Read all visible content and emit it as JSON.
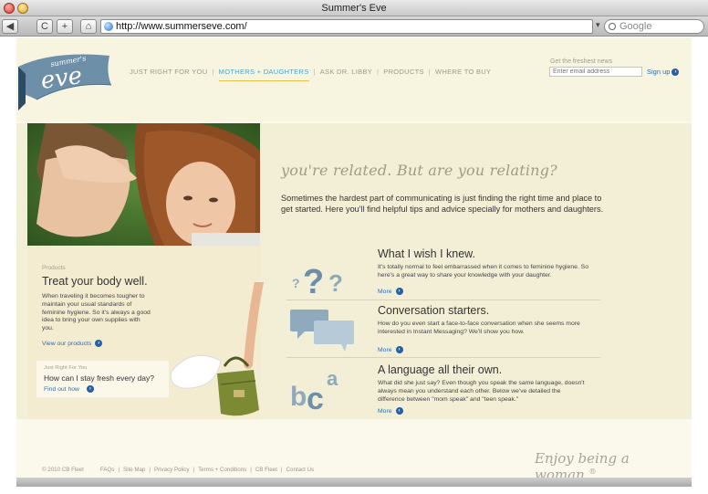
{
  "browser": {
    "window_title": "Summer's Eve",
    "url": "http://www.summerseve.com/",
    "search_placeholder": "Google",
    "buttons": {
      "back": "◀",
      "reload": "C",
      "add": "+",
      "home": "⌂"
    }
  },
  "brand": {
    "logo_small": "summer's",
    "logo_large": "eve",
    "colors": {
      "logo_blue": "#6d8fa8",
      "link_blue": "#2a6fb0",
      "nav_active": "#4aa5c8",
      "underline_gold": "#e6c14a"
    }
  },
  "nav": {
    "items": [
      {
        "label": "JUST RIGHT FOR YOU",
        "active": false
      },
      {
        "label": "MOTHERS + DAUGHTERS",
        "active": true
      },
      {
        "label": "ASK DR. LIBBY",
        "active": false
      },
      {
        "label": "PRODUCTS",
        "active": false
      },
      {
        "label": "WHERE TO BUY",
        "active": false
      }
    ],
    "separator": "|"
  },
  "newsletter": {
    "label": "Get the freshest news",
    "placeholder": "Enter email address",
    "signup_label": "Sign up"
  },
  "hero": {
    "tagline": "you're related. But are you relating?",
    "intro": "Sometimes the hardest part of communicating is just finding the right time and place to get started. Here you'll find helpful tips and advice specially for mothers and daughters."
  },
  "products_panel": {
    "eyebrow": "Products",
    "title": "Treat your body well.",
    "body": "When traveling it becomes tougher to maintain your usual standards of feminine hygiene. So it's always a good idea to bring your own supplies with you.",
    "link": "View our products"
  },
  "just_right_panel": {
    "eyebrow": "Just Right For You",
    "title": "How can I stay fresh every day?",
    "link": "Find out how"
  },
  "features": [
    {
      "icon": "question-marks-icon",
      "title": "What I wish I knew.",
      "body": "It's totally normal to feel embarrassed when it comes to feminine hygiene. So here's a great way to share your knowledge with your daughter.",
      "more": "More"
    },
    {
      "icon": "speech-bubbles-icon",
      "title": "Conversation starters.",
      "body": "How do you even start a face-to-face conversation when she seems more interested in Instant Messaging? We'll show you how.",
      "more": "More"
    },
    {
      "icon": "letters-icon",
      "title": "A language all their own.",
      "body": "What did she just say? Even though you speak the same language, doesn't always mean you understand each other. Below we've detailed the difference between \"mom speak\" and \"teen speak.\"",
      "more": "More"
    }
  ],
  "footer": {
    "copyright": "© 2010 CB Fleet",
    "links": [
      "FAQs",
      "Site Map",
      "Privacy Policy",
      "Terms + Conditions",
      "CB Fleet",
      "Contact Us"
    ],
    "slogan": "Enjoy being a woman.",
    "slogan_mark": "®"
  }
}
